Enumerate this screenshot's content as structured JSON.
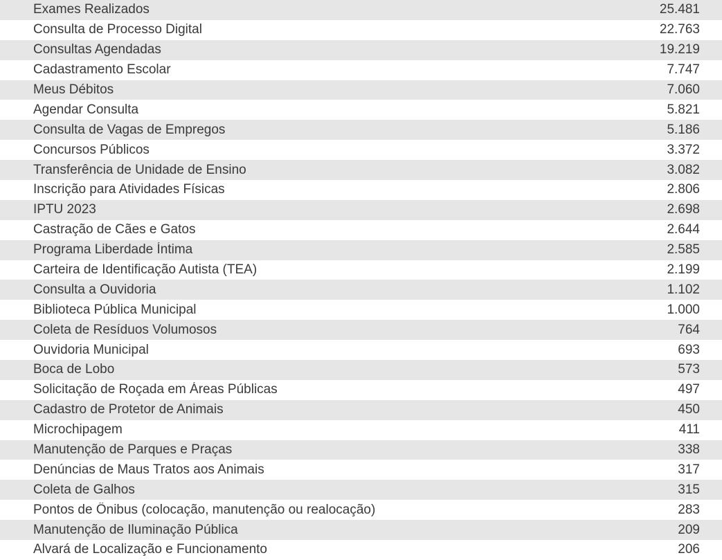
{
  "rows": [
    {
      "label": "Exames Realizados",
      "value": "25.481"
    },
    {
      "label": "Consulta de Processo Digital",
      "value": "22.763"
    },
    {
      "label": "Consultas Agendadas",
      "value": "19.219"
    },
    {
      "label": "Cadastramento Escolar",
      "value": "7.747"
    },
    {
      "label": "Meus Débitos",
      "value": "7.060"
    },
    {
      "label": "Agendar Consulta",
      "value": "5.821"
    },
    {
      "label": "Consulta de Vagas de Empregos",
      "value": "5.186"
    },
    {
      "label": "Concursos Públicos",
      "value": "3.372"
    },
    {
      "label": "Transferência de Unidade de Ensino",
      "value": "3.082"
    },
    {
      "label": "Inscrição para Atividades Físicas",
      "value": "2.806"
    },
    {
      "label": "IPTU 2023",
      "value": "2.698"
    },
    {
      "label": "Castração de Cães e Gatos",
      "value": "2.644"
    },
    {
      "label": "Programa Liberdade Íntima",
      "value": "2.585"
    },
    {
      "label": "Carteira de Identificação Autista (TEA)",
      "value": "2.199"
    },
    {
      "label": "Consulta a Ouvidoria",
      "value": "1.102"
    },
    {
      "label": "Biblioteca Pública Municipal",
      "value": "1.000"
    },
    {
      "label": "Coleta de Resíduos Volumosos",
      "value": "764"
    },
    {
      "label": "Ouvidoria Municipal",
      "value": "693"
    },
    {
      "label": "Boca de Lobo",
      "value": "573"
    },
    {
      "label": "Solicitação de Roçada em Áreas Públicas",
      "value": "497"
    },
    {
      "label": "Cadastro de Protetor de Animais",
      "value": "450"
    },
    {
      "label": "Microchipagem",
      "value": "411"
    },
    {
      "label": "Manutenção de Parques e Praças",
      "value": "338"
    },
    {
      "label": "Denúncias de Maus Tratos aos Animais",
      "value": "317"
    },
    {
      "label": "Coleta de Galhos",
      "value": "315"
    },
    {
      "label": "Pontos de Ônibus (colocação, manutenção ou realocação)",
      "value": "283"
    },
    {
      "label": "Manutenção de Iluminação Pública",
      "value": "209"
    },
    {
      "label": "Alvará de Localização e Funcionamento",
      "value": "206"
    }
  ]
}
